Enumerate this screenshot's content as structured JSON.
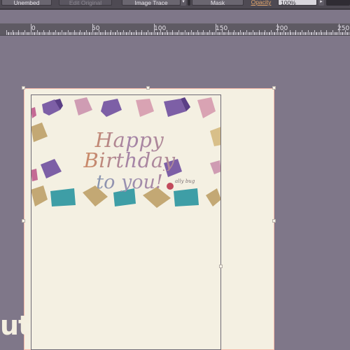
{
  "control_bar": {
    "embed_label": "Unembed",
    "edit_original_label": "Edit Original",
    "image_trace_label": "Image Trace",
    "dropdown_glyph": "▾",
    "mask_label": "Mask",
    "opacity_label": "Opacity",
    "opacity_value": "100%",
    "dropdown_glyph_2": "▸"
  },
  "ruler": {
    "labels": [
      "0",
      "50",
      "100",
      "150",
      "200",
      "250"
    ]
  },
  "card": {
    "line1": "Happy Birthday",
    "line2": "to you!",
    "signature": "ally bug"
  },
  "overlay": {
    "partial_text": "ut"
  },
  "colors": {
    "canvas": "#7f7789",
    "artboard": "#f4f0e2",
    "selection": "#f5b8a8",
    "gift_purple": "#7d5fa6",
    "gift_pink": "#cf9cb3",
    "gift_tan": "#c3a874",
    "gift_teal": "#3e9ea6"
  }
}
